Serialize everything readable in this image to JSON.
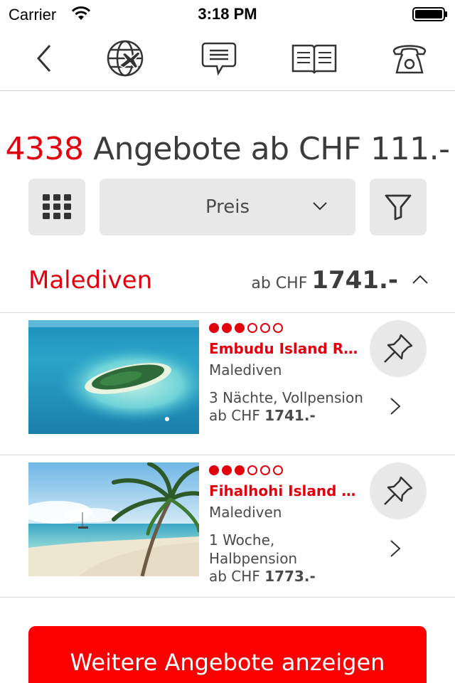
{
  "status_bar": {
    "carrier": "Carrier",
    "time": "3:18 PM"
  },
  "nav": {
    "items": [
      {
        "icon": "chevron-left-icon"
      },
      {
        "icon": "globe-plane-icon"
      },
      {
        "icon": "chat-bubble-icon"
      },
      {
        "icon": "open-book-icon"
      },
      {
        "icon": "telephone-icon"
      }
    ]
  },
  "headline": {
    "count": "4338",
    "text": " Angebote ab CHF 111.-"
  },
  "toolbar": {
    "sort_label": "Preis"
  },
  "section": {
    "title": "Malediven",
    "price_prefix": "ab CHF",
    "price_amount": "1741.-"
  },
  "offers": [
    {
      "rating": 3,
      "rating_max": 6,
      "title": "Embudu Island Resort",
      "region": "Malediven",
      "details": "3 Nächte, Vollpension",
      "price_prefix": "ab CHF ",
      "price": "1741.-"
    },
    {
      "rating": 3,
      "rating_max": 6,
      "title": "Fihalhohi Island Resort",
      "region": "Malediven",
      "details": "1 Woche, Halbpension",
      "price_prefix": "ab CHF ",
      "price": "1773.-"
    }
  ],
  "cta": {
    "label": "Weitere Angebote anzeigen"
  },
  "colors": {
    "accent": "#e2000f",
    "cta": "#fb0000",
    "button_bg": "#e8e8e8"
  }
}
